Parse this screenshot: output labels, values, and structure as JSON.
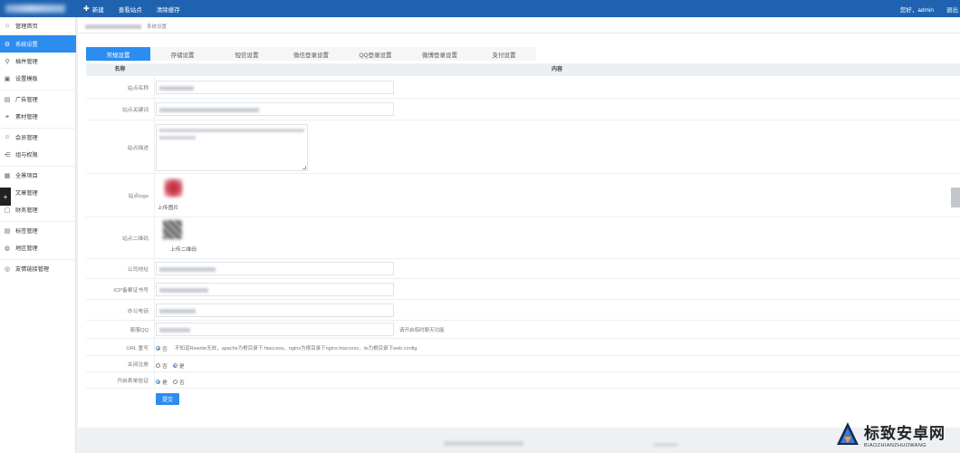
{
  "topbar": {
    "new_label": "新建",
    "view_site_label": "查看站点",
    "clear_cache_label": "清除缓存",
    "greeting": "您好，admin",
    "logout_label": "退出"
  },
  "sidebar": {
    "items": [
      {
        "label": "管理首页",
        "icon": "home-icon"
      },
      {
        "label": "系统设置",
        "icon": "gear-icon"
      },
      {
        "label": "插件管理",
        "icon": "plug-icon"
      },
      {
        "label": "设置模板",
        "icon": "template-icon"
      },
      {
        "label": "广告管理",
        "icon": "ad-icon"
      },
      {
        "label": "素材管理",
        "icon": "link-icon"
      },
      {
        "label": "会员管理",
        "icon": "user-icon"
      },
      {
        "label": "组与权限",
        "icon": "share-icon"
      },
      {
        "label": "全景项目",
        "icon": "grid-icon"
      },
      {
        "label": "文章管理",
        "icon": "doc-icon"
      },
      {
        "label": "财务管理",
        "icon": "wallet-icon"
      },
      {
        "label": "标签管理",
        "icon": "tag-icon"
      },
      {
        "label": "地区管理",
        "icon": "globe-icon"
      },
      {
        "label": "友情链接管理",
        "icon": "link-circle-icon"
      }
    ],
    "active_index": 1
  },
  "breadcrumb": {
    "current": "系统设置"
  },
  "tabs": [
    "常规设置",
    "存储设置",
    "短信设置",
    "微信登录设置",
    "QQ登录设置",
    "微博登录设置",
    "支付设置"
  ],
  "table": {
    "header_name": "名称",
    "header_content": "内容"
  },
  "form": {
    "site_name_label": "站点名称",
    "site_keywords_label": "站点关键词",
    "site_desc_label": "站点描述",
    "site_logo_label": "站点logo",
    "upload_image_label": "上传图片",
    "site_qrcode_label": "站点二维码",
    "upload_qrcode_label": "上传二维码",
    "company_address_label": "公司地址",
    "icp_label": "ICP备案证书号",
    "office_phone_label": "办公电话",
    "cs_qq_label": "客服QQ",
    "qq_hint": "请开启临时聊天功能",
    "url_rewrite_label": "URL 重写",
    "url_rewrite_opt_no": "否",
    "url_rewrite_hint": "不知道Rewrite无效，apache为根目录下.htaccess，nginx为根目录下nginx.htaccess，iis为根目录下web.config",
    "no_register_label": "关闭注册",
    "no_register_opt_no": "否",
    "no_register_opt_yes": "是",
    "captcha_label": "开启表单验证",
    "captcha_opt_yes": "是",
    "captcha_opt_no": "否",
    "submit_label": "提交"
  },
  "watermark": {
    "cn": "标致安卓网",
    "en": "BIAOZHIANZHUOWANG"
  },
  "colors": {
    "topbar": "#1f63b0",
    "accent": "#2d8cf0"
  }
}
